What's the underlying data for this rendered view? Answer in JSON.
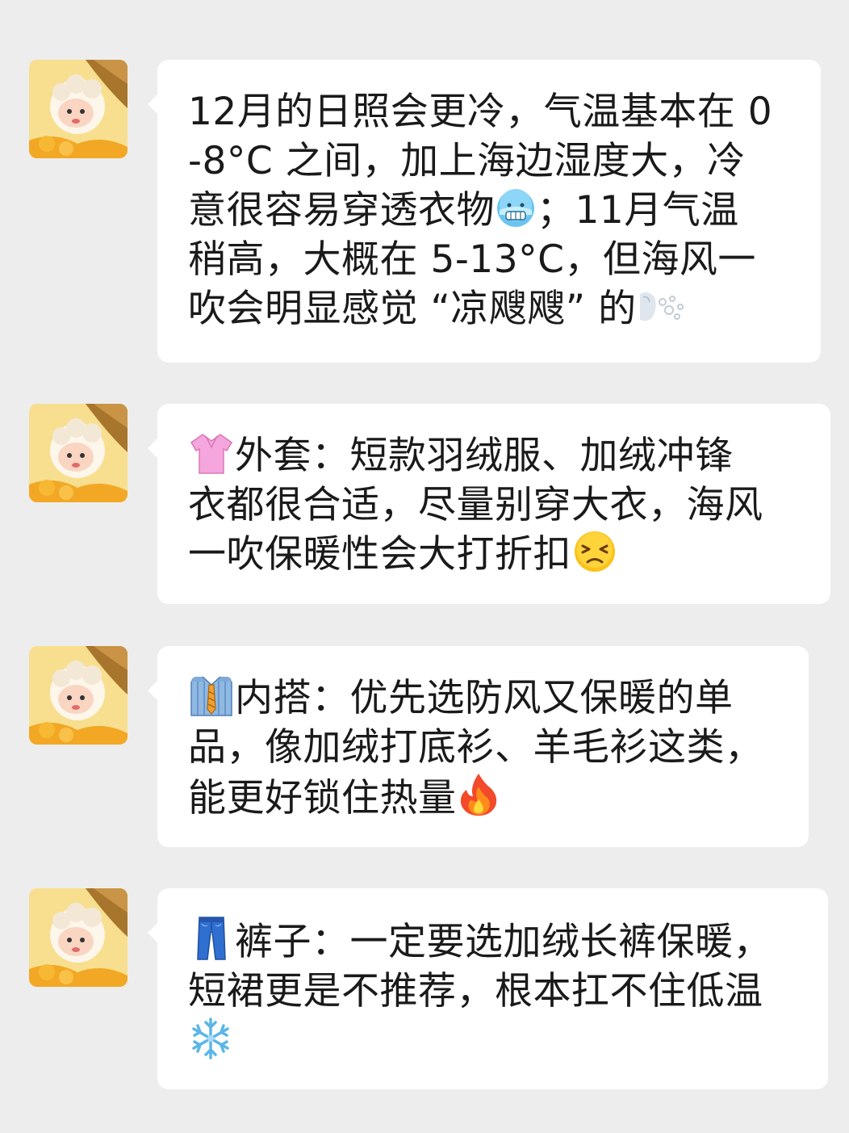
{
  "messages": [
    {
      "lines": [
        "12月的日照会更冷，气温基本在 0",
        "-8°C 之间，加上海边湿度大，冷",
        "意很容易穿透衣物",
        "稍高，大概在 5-13°C，但海风一",
        "吹会明显感觉 “凉飕飕” 的"
      ],
      "line3_suffix": "；11月气温",
      "emojis": [
        "cold-face-emoji",
        "wind-face-emoji"
      ]
    },
    {
      "line1_prefix": "外套：短款羽绒服、加绒冲锋",
      "lines": [
        "衣都很合适，尽量别穿大衣，海风",
        "一吹保暖性会大打折扣"
      ],
      "emojis": [
        "blouse-emoji",
        "persevering-face-emoji"
      ]
    },
    {
      "line1_prefix": "内搭：优先选防风又保暖的单",
      "lines": [
        "品，像加绒打底衫、羊毛衫这类，",
        "能更好锁住热量"
      ],
      "emojis": [
        "shirt-tie-emoji",
        "fire-emoji"
      ]
    },
    {
      "line1_prefix": "裤子：一定要选加绒长裤保暖，",
      "lines": [
        "短裙更是不推荐，根本扛不住低温"
      ],
      "emojis": [
        "jeans-emoji",
        "snowflake-emoji"
      ]
    }
  ]
}
